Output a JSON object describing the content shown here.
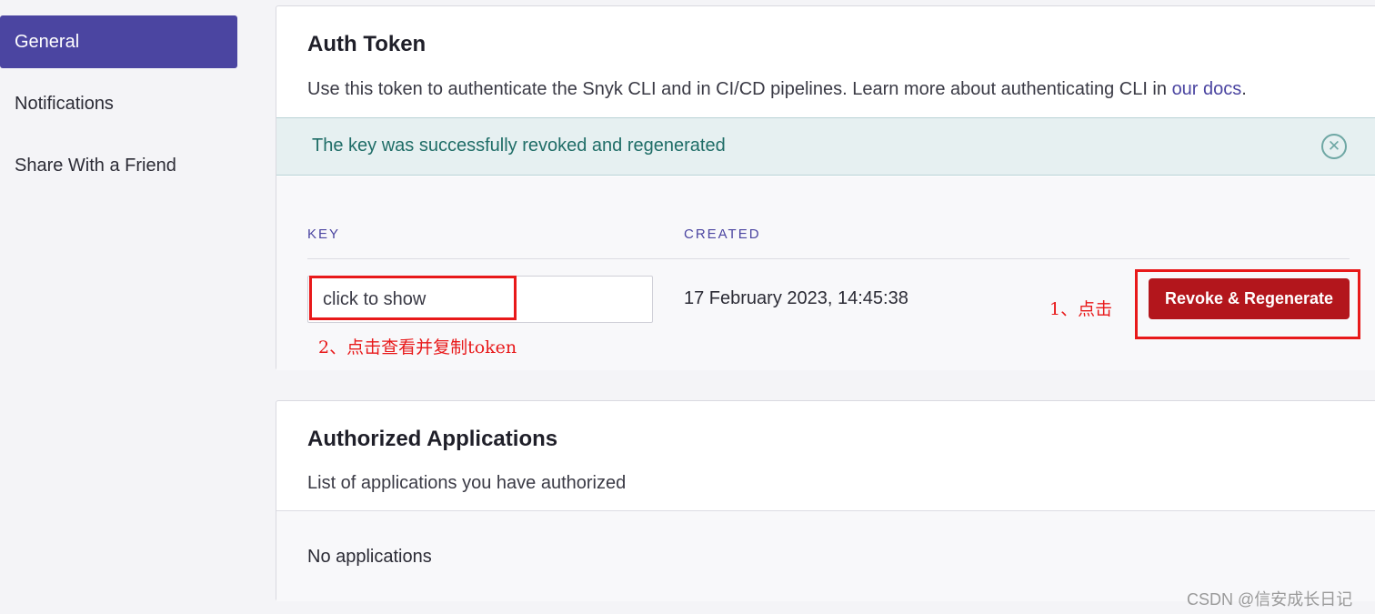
{
  "sidebar": {
    "items": [
      {
        "label": "General",
        "active": true
      },
      {
        "label": "Notifications",
        "active": false
      },
      {
        "label": "Share With a Friend",
        "active": false
      }
    ]
  },
  "auth_token": {
    "title": "Auth Token",
    "description": "Use this token to authenticate the Snyk CLI and in CI/CD pipelines. Learn more about authenticating CLI in ",
    "docs_link": "our docs",
    "description_end": ".",
    "alert_message": "The key was successfully revoked and regenerated",
    "alert_close_icon": "close-circle-icon",
    "columns": {
      "key": "KEY",
      "created": "CREATED"
    },
    "key_value": "click to show",
    "created_value": "17 February 2023, 14:45:38",
    "revoke_button": "Revoke & Regenerate"
  },
  "authorized_apps": {
    "title": "Authorized Applications",
    "description": "List of applications you have authorized",
    "empty_text": "No applications"
  },
  "annotations": {
    "step1": "1、点击",
    "step2": "2、点击查看并复制token"
  },
  "watermark": "CSDN @信安成长日记",
  "colors": {
    "accent": "#4b45a1",
    "danger": "#b3161c",
    "alert_bg": "#e6f0f1",
    "alert_text": "#1f6d67",
    "annotation": "#e8191a"
  }
}
